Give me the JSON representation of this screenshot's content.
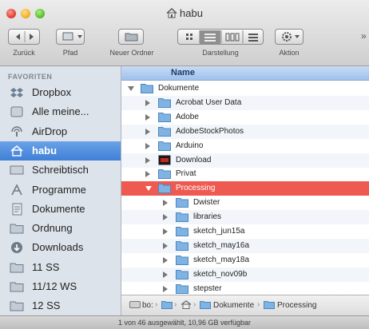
{
  "window": {
    "title": "habu"
  },
  "toolbar": {
    "back_label": "Zurück",
    "path_label": "Pfad",
    "new_folder_label": "Neuer Ordner",
    "view_label": "Darstellung",
    "action_label": "Aktion"
  },
  "sidebar": {
    "header": "FAVORITEN",
    "items": [
      {
        "label": "Dropbox",
        "icon": "dropbox-icon"
      },
      {
        "label": "Alle meine...",
        "icon": "all-files-icon"
      },
      {
        "label": "AirDrop",
        "icon": "airdrop-icon"
      },
      {
        "label": "habu",
        "icon": "home-icon",
        "selected": true
      },
      {
        "label": "Schreibtisch",
        "icon": "desktop-icon"
      },
      {
        "label": "Programme",
        "icon": "applications-icon"
      },
      {
        "label": "Dokumente",
        "icon": "documents-icon"
      },
      {
        "label": "Ordnung",
        "icon": "folder-icon"
      },
      {
        "label": "Downloads",
        "icon": "downloads-icon"
      },
      {
        "label": "11 SS",
        "icon": "folder-icon"
      },
      {
        "label": "11/12 WS",
        "icon": "folder-icon"
      },
      {
        "label": "12 SS",
        "icon": "folder-icon"
      }
    ]
  },
  "list": {
    "column_name": "Name",
    "rows": [
      {
        "name": "Dokumente",
        "level": 0,
        "expanded": true
      },
      {
        "name": "Acrobat User Data",
        "level": 1,
        "expanded": false
      },
      {
        "name": "Adobe",
        "level": 1,
        "expanded": false
      },
      {
        "name": "AdobeStockPhotos",
        "level": 1,
        "expanded": false
      },
      {
        "name": "Arduino",
        "level": 1,
        "expanded": false
      },
      {
        "name": "Download",
        "level": 1,
        "expanded": false,
        "special": true
      },
      {
        "name": "Privat",
        "level": 1,
        "expanded": false
      },
      {
        "name": "Processing",
        "level": 1,
        "expanded": true,
        "selected": true
      },
      {
        "name": "Dwister",
        "level": 2,
        "expanded": false
      },
      {
        "name": "libraries",
        "level": 2,
        "expanded": false
      },
      {
        "name": "sketch_jun15a",
        "level": 2,
        "expanded": false
      },
      {
        "name": "sketch_may16a",
        "level": 2,
        "expanded": false
      },
      {
        "name": "sketch_may18a",
        "level": 2,
        "expanded": false
      },
      {
        "name": "sketch_nov09b",
        "level": 2,
        "expanded": false
      },
      {
        "name": "stepster",
        "level": 2,
        "expanded": false
      }
    ]
  },
  "pathbar": {
    "crumbs": [
      "bo:",
      "Dokumente",
      "Processing"
    ]
  },
  "status": {
    "text": "1 von 46 ausgewählt, 10,96 GB verfügbar"
  },
  "colors": {
    "selection": "#ee5a51",
    "sidebar_selection": "#3f7fd6",
    "folder": "#7fb3e3"
  }
}
